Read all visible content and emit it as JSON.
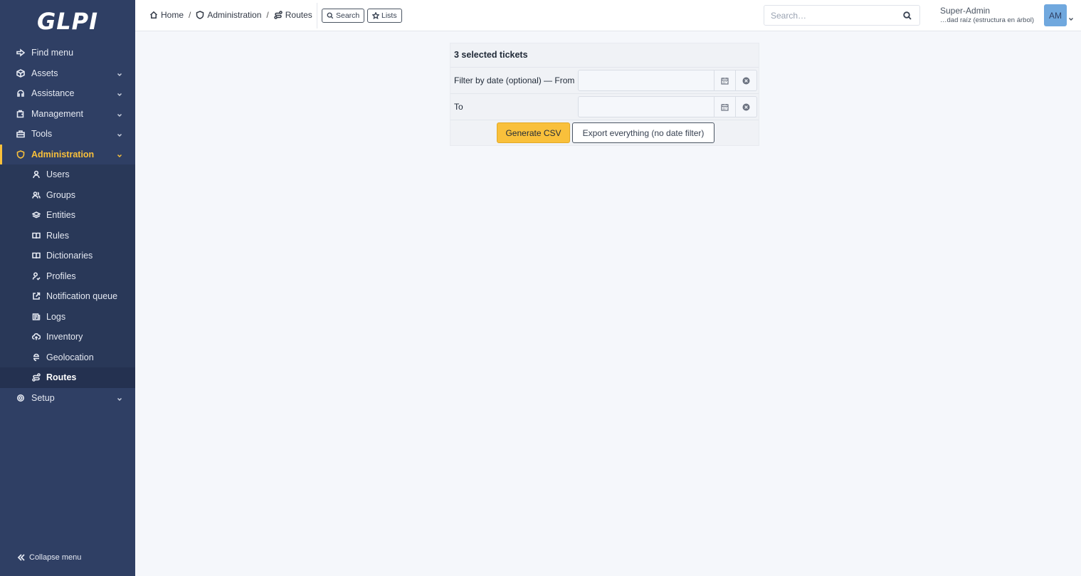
{
  "app": {
    "logo": "GLPI"
  },
  "sidebar": {
    "items": [
      {
        "label": "Find menu",
        "icon": "arrow-right-icon"
      },
      {
        "label": "Assets",
        "icon": "box-icon"
      },
      {
        "label": "Assistance",
        "icon": "headset-icon"
      },
      {
        "label": "Management",
        "icon": "wallet-icon"
      },
      {
        "label": "Tools",
        "icon": "briefcase-icon"
      },
      {
        "label": "Administration",
        "icon": "shield-icon"
      },
      {
        "label": "Setup",
        "icon": "gear-icon"
      }
    ],
    "sub_items": [
      {
        "label": "Users",
        "icon": "user-icon"
      },
      {
        "label": "Groups",
        "icon": "users-icon"
      },
      {
        "label": "Entities",
        "icon": "layers-icon"
      },
      {
        "label": "Rules",
        "icon": "book-icon"
      },
      {
        "label": "Dictionaries",
        "icon": "book-icon"
      },
      {
        "label": "Profiles",
        "icon": "user-check-icon"
      },
      {
        "label": "Notification queue",
        "icon": "external-link-icon"
      },
      {
        "label": "Logs",
        "icon": "news-icon"
      },
      {
        "label": "Inventory",
        "icon": "cloud-upload-icon"
      },
      {
        "label": "Geolocation",
        "icon": "location-icon"
      },
      {
        "label": "Routes",
        "icon": "route-icon"
      }
    ],
    "collapse_label": "Collapse menu"
  },
  "header": {
    "breadcrumb": [
      "Home",
      "Administration",
      "Routes"
    ],
    "search_btn": "Search",
    "lists_btn": "Lists",
    "search_placeholder": "Search…",
    "user_name": "Super-Admin",
    "user_entity": "…dad raíz (estructura en árbol)",
    "avatar_initials": "AM"
  },
  "form": {
    "title": "3 selected tickets",
    "from_label": "Filter by date (optional) — From",
    "to_label": "To",
    "generate_label": "Generate CSV",
    "export_label": "Export everything (no date filter)"
  },
  "colors": {
    "sidebar": "#2f3f64",
    "accent": "#f9c03b",
    "avatar": "#70a8de"
  }
}
